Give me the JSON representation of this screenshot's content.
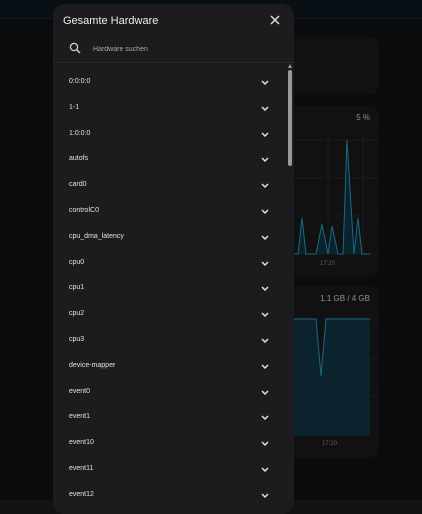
{
  "dashboard": {
    "cpu_card": {
      "value": "5 %",
      "time_label": "17:20"
    },
    "memory_card": {
      "value": "1.1 GB / 4 GB",
      "time_label": "17:20"
    },
    "accent_color": "#2aa8d6"
  },
  "dialog": {
    "title": "Gesamte Hardware",
    "close_icon": "close-icon",
    "search": {
      "icon": "search-icon",
      "placeholder": "Hardware suchen",
      "value": ""
    },
    "items": [
      {
        "label": "0:0:0:0"
      },
      {
        "label": "1-1"
      },
      {
        "label": "1:0:0:0"
      },
      {
        "label": "autofs"
      },
      {
        "label": "card0"
      },
      {
        "label": "controlC0"
      },
      {
        "label": "cpu_dma_latency"
      },
      {
        "label": "cpu0"
      },
      {
        "label": "cpu1"
      },
      {
        "label": "cpu2"
      },
      {
        "label": "cpu3"
      },
      {
        "label": "device-mapper"
      },
      {
        "label": "event0"
      },
      {
        "label": "event1"
      },
      {
        "label": "event10"
      },
      {
        "label": "event11"
      },
      {
        "label": "event12"
      }
    ],
    "item_icon": "chevron-down-icon"
  }
}
